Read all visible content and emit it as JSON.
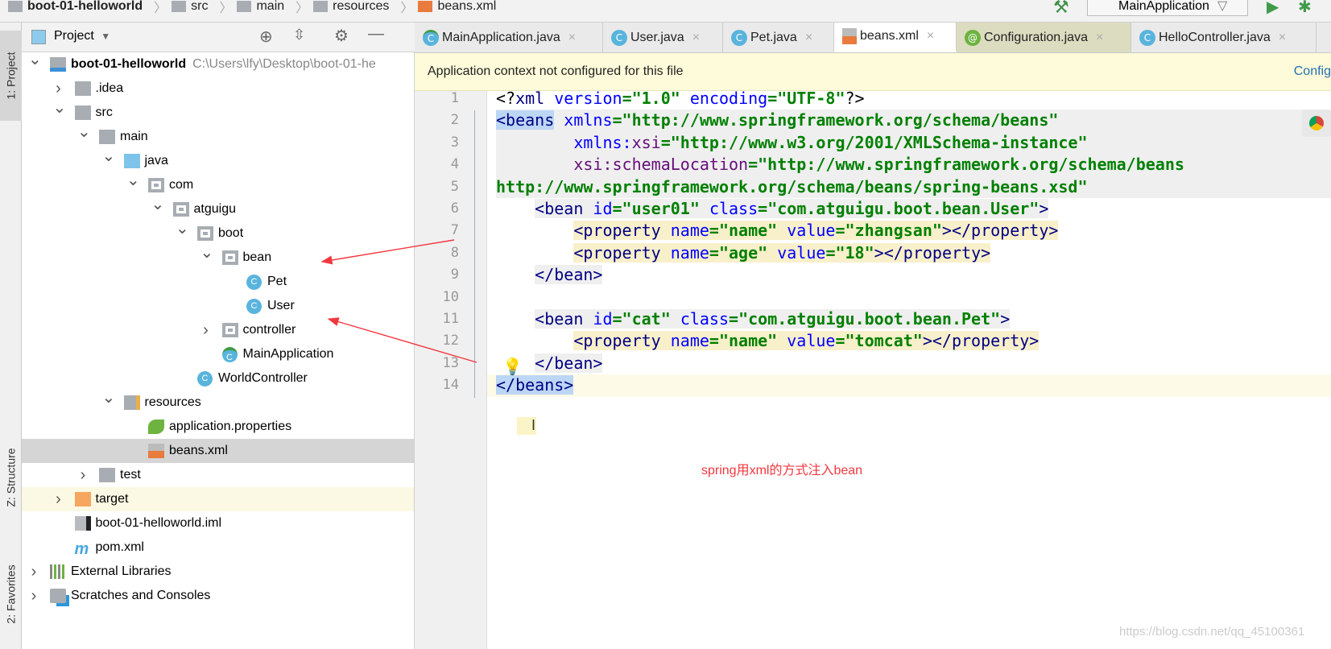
{
  "breadcrumb": [
    "boot-01-helloworld",
    "src",
    "main",
    "resources",
    "beans.xml"
  ],
  "toolbar": {
    "run_config": "MainApplication",
    "icons": [
      "hammer-icon",
      "run-icon",
      "debug-icon"
    ]
  },
  "side_tabs": [
    "1: Project",
    "Z: Structure",
    "2: Favorites"
  ],
  "project_panel": {
    "title": "Project",
    "icons": [
      "locate-icon",
      "collapse-icon",
      "gear-icon",
      "minimize-icon"
    ],
    "tree": [
      {
        "level": 0,
        "arrow": "open",
        "icon": "module",
        "label": "boot-01-helloworld",
        "extra": "C:\\Users\\lfy\\Desktop\\boot-01-he",
        "bold": true
      },
      {
        "level": 1,
        "arrow": "closed",
        "icon": "folder",
        "label": ".idea"
      },
      {
        "level": 1,
        "arrow": "open",
        "icon": "folder",
        "label": "src"
      },
      {
        "level": 2,
        "arrow": "open",
        "icon": "folder",
        "label": "main"
      },
      {
        "level": 3,
        "arrow": "open",
        "icon": "folder-blue",
        "label": "java"
      },
      {
        "level": 4,
        "arrow": "open",
        "icon": "package",
        "label": "com"
      },
      {
        "level": 5,
        "arrow": "open",
        "icon": "package",
        "label": "atguigu"
      },
      {
        "level": 6,
        "arrow": "open",
        "icon": "package",
        "label": "boot"
      },
      {
        "level": 7,
        "arrow": "open",
        "icon": "package",
        "label": "bean"
      },
      {
        "level": 8,
        "arrow": "none",
        "icon": "class",
        "label": "Pet"
      },
      {
        "level": 8,
        "arrow": "none",
        "icon": "class",
        "label": "User"
      },
      {
        "level": 7,
        "arrow": "closed",
        "icon": "package",
        "label": "controller"
      },
      {
        "level": 7,
        "arrow": "none",
        "icon": "spring-class",
        "label": "MainApplication"
      },
      {
        "level": 6,
        "arrow": "none",
        "icon": "class",
        "label": "WorldController"
      },
      {
        "level": 3,
        "arrow": "open",
        "icon": "resources-folder",
        "label": "resources"
      },
      {
        "level": 4,
        "arrow": "none",
        "icon": "spring-properties",
        "label": "application.properties"
      },
      {
        "level": 4,
        "arrow": "none",
        "icon": "xml-spring",
        "label": "beans.xml",
        "selected": true
      },
      {
        "level": 2,
        "arrow": "closed",
        "icon": "folder",
        "label": "test"
      },
      {
        "level": 1,
        "arrow": "closed",
        "icon": "folder-orange",
        "label": "target",
        "highlight": true
      },
      {
        "level": 1,
        "arrow": "none",
        "icon": "iml",
        "label": "boot-01-helloworld.iml"
      },
      {
        "level": 1,
        "arrow": "none",
        "icon": "maven",
        "label": "pom.xml"
      },
      {
        "level": 0,
        "arrow": "closed",
        "icon": "libraries",
        "label": "External Libraries"
      },
      {
        "level": 0,
        "arrow": "closed",
        "icon": "scratches",
        "label": "Scratches and Consoles"
      }
    ]
  },
  "tabs": [
    {
      "label": "MainApplication.java",
      "icon": "spring-class"
    },
    {
      "label": "User.java",
      "icon": "class"
    },
    {
      "label": "Pet.java",
      "icon": "class"
    },
    {
      "label": "beans.xml",
      "icon": "xml-spring",
      "active": true
    },
    {
      "label": "Configuration.java",
      "icon": "annotation"
    },
    {
      "label": "HelloController.java",
      "icon": "class"
    }
  ],
  "banner": {
    "message": "Application context not configured for this file",
    "action": "Config"
  },
  "editor": {
    "lines": [
      [
        [
          "<?",
          "pi"
        ],
        [
          "xml ",
          "tg"
        ],
        [
          "version",
          "an"
        ],
        [
          "=\"1.0\" ",
          "av"
        ],
        [
          "encoding",
          "an"
        ],
        [
          "=\"UTF-8\"",
          "av"
        ],
        [
          "?>",
          "pi"
        ]
      ],
      [
        [
          "<beans",
          "tg hb"
        ],
        [
          " ",
          ""
        ],
        [
          "xmlns",
          "an"
        ],
        [
          "=\"http://www.springframework.org/schema/beans\"",
          "av"
        ]
      ],
      [
        [
          "        ",
          ""
        ],
        [
          "xmlns:",
          "an"
        ],
        [
          "xsi",
          "ns"
        ],
        [
          "=\"http://www.w3.org/2001/XMLSchema-instance\"",
          "av"
        ]
      ],
      [
        [
          "        ",
          ""
        ],
        [
          "xsi:",
          "ns"
        ],
        [
          "schemaLocation",
          "ns"
        ],
        [
          "=\"http://www.springframework.org/schema/beans http://www.springframework.org/schema/beans/spring-beans.xsd\"",
          "av"
        ]
      ],
      [],
      [
        [
          "    ",
          ""
        ],
        [
          "<bean ",
          "tg hg"
        ],
        [
          "id",
          "an hg"
        ],
        [
          "=\"user01\" ",
          "av hg"
        ],
        [
          "class",
          "an hg"
        ],
        [
          "=\"com.atguigu.boot.bean.User\"",
          "av hg"
        ],
        [
          ">",
          "tg hg"
        ]
      ],
      [
        [
          "        ",
          ""
        ],
        [
          "<property ",
          "tg hy"
        ],
        [
          "name",
          "an hy"
        ],
        [
          "=\"name\" ",
          "av hy"
        ],
        [
          "value",
          "an hy"
        ],
        [
          "=\"zhangsan\"",
          "av hy"
        ],
        [
          "></property>",
          "tg hy"
        ]
      ],
      [
        [
          "        ",
          ""
        ],
        [
          "<property ",
          "tg hy"
        ],
        [
          "name",
          "an hy"
        ],
        [
          "=\"age\" ",
          "av hy"
        ],
        [
          "value",
          "an hy"
        ],
        [
          "=\"18\"",
          "av hy"
        ],
        [
          "></property>",
          "tg hy"
        ]
      ],
      [
        [
          "    ",
          ""
        ],
        [
          "</bean>",
          "tg hg"
        ]
      ],
      [],
      [
        [
          "    ",
          ""
        ],
        [
          "<bean ",
          "tg hg"
        ],
        [
          "id",
          "an hg"
        ],
        [
          "=\"cat\" ",
          "av hg"
        ],
        [
          "class",
          "an hg"
        ],
        [
          "=\"com.atguigu.boot.bean.Pet\"",
          "av hg"
        ],
        [
          ">",
          "tg hg"
        ]
      ],
      [
        [
          "        ",
          ""
        ],
        [
          "<property ",
          "tg hy"
        ],
        [
          "name",
          "an hy"
        ],
        [
          "=\"name\" ",
          "av hy"
        ],
        [
          "value",
          "an hy"
        ],
        [
          "=\"tomcat\"",
          "av hy"
        ],
        [
          "></property>",
          "tg hy"
        ]
      ],
      [
        [
          "    ",
          ""
        ],
        [
          "</bean>",
          "tg hg"
        ]
      ],
      [
        [
          "</beans>",
          "tg hb"
        ]
      ]
    ]
  },
  "annotation": {
    "note": "spring用xml的方式注入bean",
    "arrow_color": "#f0383f"
  },
  "watermark": "https://blog.csdn.net/qq_45100361"
}
